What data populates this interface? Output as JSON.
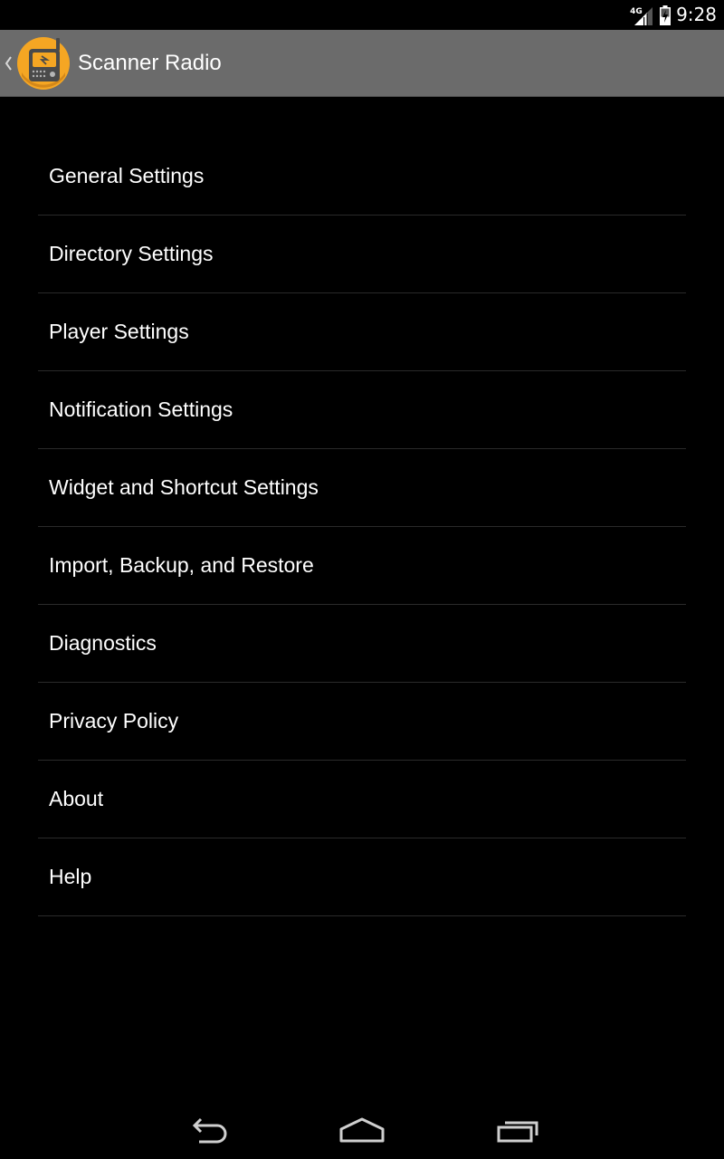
{
  "status_bar": {
    "network": "4G",
    "time": "9:28",
    "icons": [
      "signal-icon",
      "battery-icon"
    ]
  },
  "action_bar": {
    "title": "Scanner Radio",
    "up_icon": "chevron-left-icon",
    "app_icon": "scanner-radio-app-icon",
    "app_icon_color": "#f5a623",
    "background": "#6b6b6b"
  },
  "settings": {
    "items": [
      {
        "label": "General Settings"
      },
      {
        "label": "Directory Settings"
      },
      {
        "label": "Player Settings"
      },
      {
        "label": "Notification Settings"
      },
      {
        "label": "Widget and Shortcut Settings"
      },
      {
        "label": "Import, Backup, and Restore"
      },
      {
        "label": "Diagnostics"
      },
      {
        "label": "Privacy Policy"
      },
      {
        "label": "About"
      },
      {
        "label": "Help"
      }
    ]
  },
  "nav_bar": {
    "icons": [
      "back-icon",
      "home-icon",
      "recent-apps-icon"
    ]
  }
}
